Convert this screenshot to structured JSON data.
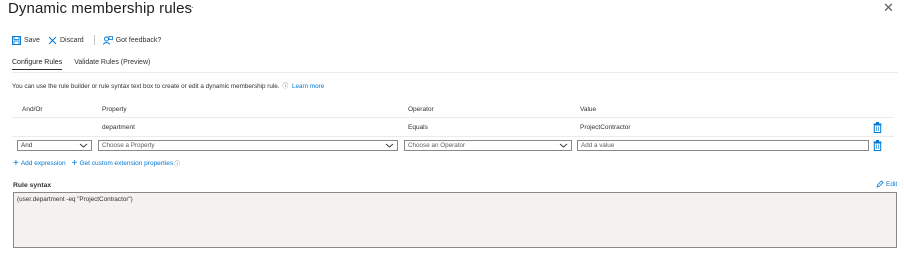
{
  "header": {
    "title": "Dynamic membership rules",
    "more": "···",
    "close": "✕"
  },
  "commands": {
    "save": "Save",
    "discard": "Discard",
    "feedback": "Got feedback?"
  },
  "tabs": [
    {
      "label": "Configure Rules",
      "active": true
    },
    {
      "label": "Validate Rules (Preview)",
      "active": false
    }
  ],
  "info": {
    "text": "You can use the rule builder or rule syntax text box to create or edit a dynamic membership rule.",
    "icon": "ⓘ",
    "link": "Learn more"
  },
  "table": {
    "headers": {
      "andor": "And/Or",
      "property": "Property",
      "operator": "Operator",
      "value": "Value"
    },
    "rows": [
      {
        "andor": "",
        "property": "department",
        "operator": "Equals",
        "value": "ProjectContractor"
      }
    ],
    "new_row": {
      "andor": "And",
      "property_placeholder": "Choose a Property",
      "operator_placeholder": "Choose an Operator",
      "value_placeholder": "Add a value"
    }
  },
  "actions": {
    "add_expression": "Add expression",
    "custom_props": "Get custom extension properties",
    "info_icon": "ⓘ"
  },
  "rule_syntax": {
    "label": "Rule syntax",
    "edit": "Edit",
    "value": "(user.department -eq \"ProjectContractor\")"
  },
  "colors": {
    "accent": "#0078d4",
    "text": "#323130",
    "border": "#8a8886",
    "syntax_bg": "#f3f2f1"
  }
}
